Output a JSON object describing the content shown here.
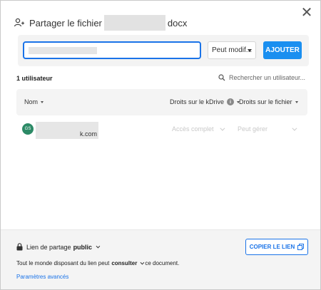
{
  "dialog": {
    "title_prefix": "Partager le fichier",
    "title_suffix": "docx",
    "close_glyph": "✕"
  },
  "add_bar": {
    "role_value": "Peut modif...",
    "add_label": "AJOUTER"
  },
  "users": {
    "count_label": "1 utilisateur",
    "search_placeholder": "Rechercher un utilisateur..."
  },
  "table": {
    "col_name": "Nom",
    "col_kdrive": "Droits sur le kDrive",
    "col_file": "Droits sur le fichier",
    "rows": [
      {
        "initials": "GS",
        "email_suffix": "k.com",
        "kdrive_right": "Accès complet",
        "file_right": "Peut gérer"
      }
    ]
  },
  "footer": {
    "link_label": "Lien de partage",
    "link_mode": "public",
    "desc_prefix": "Tout le monde disposant du lien peut",
    "desc_action": "consulter",
    "desc_suffix": "ce document.",
    "copy_label": "COPIER LE LIEN",
    "advanced_label": "Paramètres avancés"
  },
  "colors": {
    "accent": "#1a73e8",
    "button_blue": "#1a8ff0",
    "avatar_green": "#2c8a66"
  },
  "icons": [
    "users-share-icon",
    "close-icon",
    "search-icon",
    "info-icon",
    "lock-icon",
    "copy-icon"
  ]
}
